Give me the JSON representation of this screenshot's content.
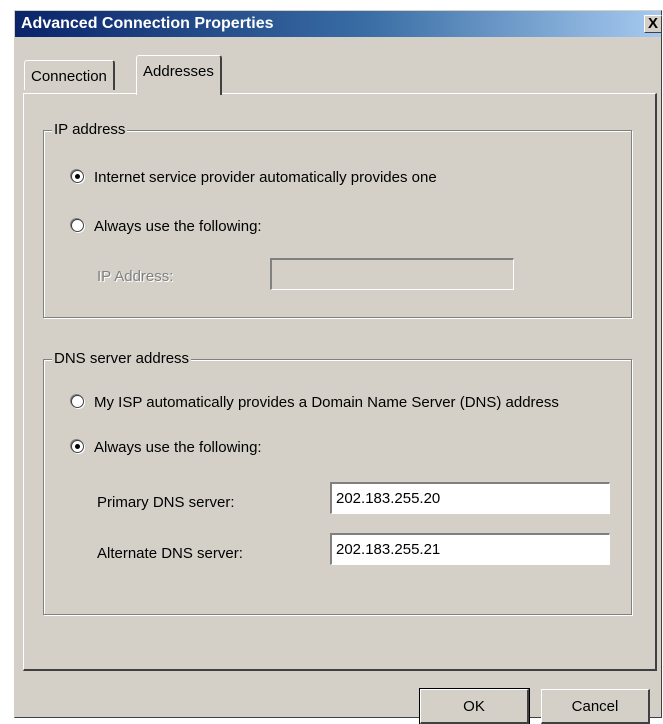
{
  "window": {
    "title": "Advanced Connection Properties",
    "close_glyph": "X"
  },
  "tabs": [
    {
      "label": "Connection",
      "selected": false
    },
    {
      "label": "Addresses",
      "selected": true
    }
  ],
  "ip_group": {
    "label": "IP address",
    "option_auto": {
      "label": "Internet service provider automatically provides one",
      "checked": true
    },
    "option_manual": {
      "label": "Always use the following:",
      "checked": false
    },
    "ip_field": {
      "label": "IP Address:",
      "value": "",
      "enabled": false
    }
  },
  "dns_group": {
    "label": "DNS server address",
    "option_auto": {
      "label": "My ISP automatically provides a Domain Name Server (DNS) address",
      "checked": false
    },
    "option_manual": {
      "label": "Always use the following:",
      "checked": true
    },
    "primary": {
      "label": "Primary DNS server:",
      "value": "202.183.255.20"
    },
    "alternate": {
      "label": "Alternate DNS server:",
      "value": "202.183.255.21"
    }
  },
  "buttons": {
    "ok": "OK",
    "cancel": "Cancel"
  }
}
